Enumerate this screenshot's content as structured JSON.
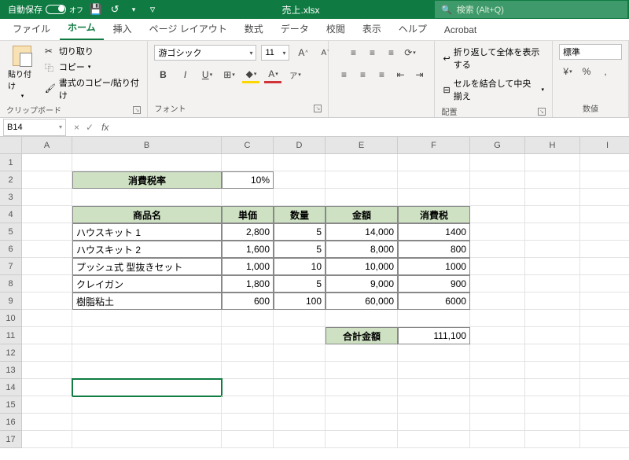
{
  "titlebar": {
    "autosave": "自動保存",
    "autosave_state": "オフ",
    "filename": "売上.xlsx",
    "search_placeholder": "検索 (Alt+Q)"
  },
  "tabs": [
    "ファイル",
    "ホーム",
    "挿入",
    "ページ レイアウト",
    "数式",
    "データ",
    "校閲",
    "表示",
    "ヘルプ",
    "Acrobat"
  ],
  "active_tab": 1,
  "ribbon": {
    "clipboard": {
      "paste": "貼り付け",
      "cut": "切り取り",
      "copy": "コピー",
      "format": "書式のコピー/貼り付け",
      "label": "クリップボード"
    },
    "font": {
      "name": "游ゴシック",
      "size": "11",
      "ruby": "ア",
      "label": "フォント"
    },
    "align": {
      "wrap": "折り返して全体を表示する",
      "merge": "セルを結合して中央揃え",
      "label": "配置"
    },
    "num": {
      "format": "標準",
      "label": "数値"
    }
  },
  "namebox": "B14",
  "formula": "",
  "cols": [
    "A",
    "B",
    "C",
    "D",
    "E",
    "F",
    "G",
    "H",
    "I"
  ],
  "rows": [
    "1",
    "2",
    "3",
    "4",
    "5",
    "6",
    "7",
    "8",
    "9",
    "10",
    "11",
    "12",
    "13",
    "14",
    "15",
    "16",
    "17"
  ],
  "sheet": {
    "b2": "消費税率",
    "c2": "10%",
    "b4": "商品名",
    "c4": "単価",
    "d4": "数量",
    "e4": "金額",
    "f4": "消費税",
    "b5": "ハウスキット 1",
    "c5": "2,800",
    "d5": "5",
    "e5": "14,000",
    "f5": "1400",
    "b6": "ハウスキット 2",
    "c6": "1,600",
    "d6": "5",
    "e6": "8,000",
    "f6": "800",
    "b7": "プッシュ式 型抜きセット",
    "c7": "1,000",
    "d7": "10",
    "e7": "10,000",
    "f7": "1000",
    "b8": "クレイガン",
    "c8": "1,800",
    "d8": "5",
    "e8": "9,000",
    "f8": "900",
    "b9": "樹脂粘土",
    "c9": "600",
    "d9": "100",
    "e9": "60,000",
    "f9": "6000",
    "e11": "合計金額",
    "f11": "111,100"
  },
  "chart_data": {
    "type": "table",
    "title": "売上",
    "tax_rate_label": "消費税率",
    "tax_rate": "10%",
    "columns": [
      "商品名",
      "単価",
      "数量",
      "金額",
      "消費税"
    ],
    "rows": [
      {
        "商品名": "ハウスキット 1",
        "単価": 2800,
        "数量": 5,
        "金額": 14000,
        "消費税": 1400
      },
      {
        "商品名": "ハウスキット 2",
        "単価": 1600,
        "数量": 5,
        "金額": 8000,
        "消費税": 800
      },
      {
        "商品名": "プッシュ式 型抜きセット",
        "単価": 1000,
        "数量": 10,
        "金額": 10000,
        "消費税": 1000
      },
      {
        "商品名": "クレイガン",
        "単価": 1800,
        "数量": 5,
        "金額": 9000,
        "消費税": 900
      },
      {
        "商品名": "樹脂粘土",
        "単価": 600,
        "数量": 100,
        "金額": 60000,
        "消費税": 6000
      }
    ],
    "total_label": "合計金額",
    "total": 111100
  }
}
